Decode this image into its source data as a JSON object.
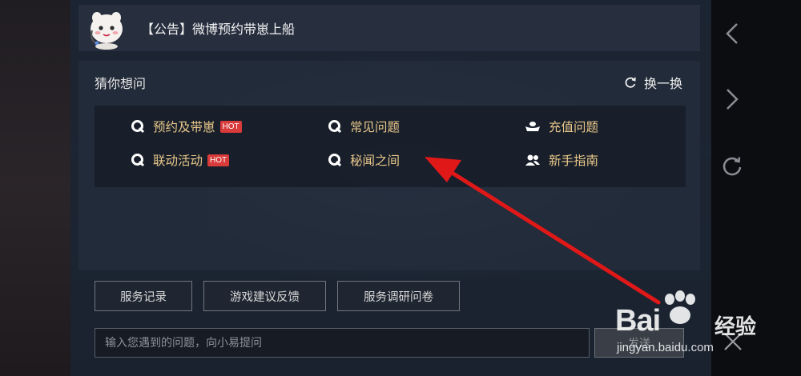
{
  "notice": {
    "text": "【公告】微博预约带崽上船"
  },
  "guess": {
    "title": "猜你想问",
    "refresh_label": "换一换",
    "items": [
      {
        "label": "预约及带崽",
        "icon": "q-icon",
        "badge": "HOT"
      },
      {
        "label": "常见问题",
        "icon": "q-icon",
        "badge": ""
      },
      {
        "label": "充值问题",
        "icon": "ingot-icon",
        "badge": ""
      },
      {
        "label": "联动活动",
        "icon": "q-icon",
        "badge": "HOT"
      },
      {
        "label": "秘闻之间",
        "icon": "q-icon",
        "badge": ""
      },
      {
        "label": "新手指南",
        "icon": "users-icon",
        "badge": ""
      }
    ]
  },
  "actions": {
    "service_record": "服务记录",
    "feedback": "游戏建议反馈",
    "survey": "服务调研问卷"
  },
  "chat": {
    "placeholder": "输入您遇到的问题，向小易提问",
    "send_label": "发送"
  },
  "watermark": {
    "brand": "Bai",
    "brand_suffix": "经验",
    "url": "jingyan.baidu.com"
  },
  "colors": {
    "accent_gold": "#e9c88b",
    "hot_badge": "#d93a3a",
    "annotation_arrow": "#e01818"
  }
}
